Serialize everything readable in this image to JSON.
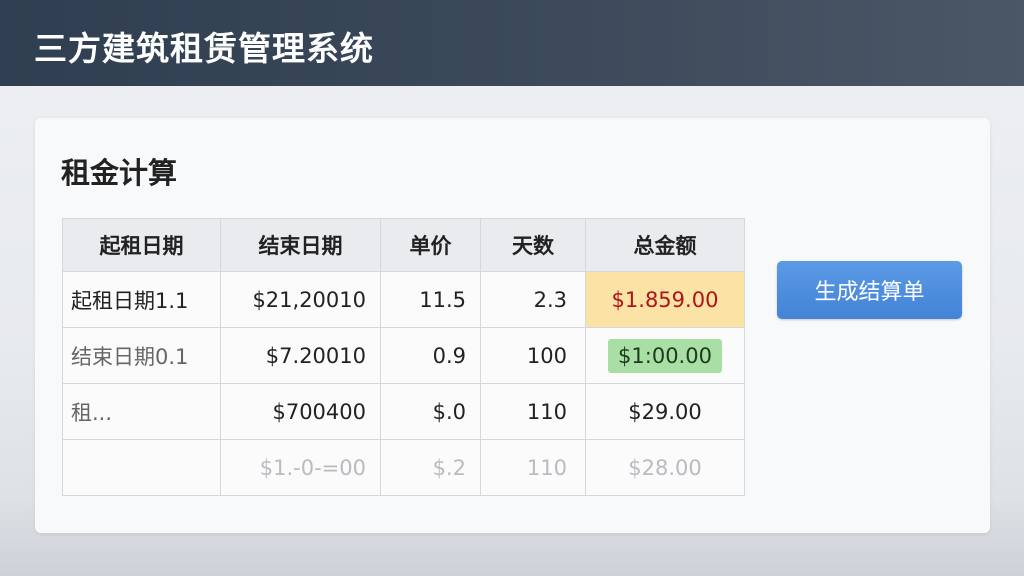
{
  "app": {
    "title": "三方建筑租赁管理系统"
  },
  "panel": {
    "title": "租金计算",
    "generate_button": "生成结算单"
  },
  "table": {
    "headers": [
      "起租日期",
      "结束日期",
      "单价",
      "天数",
      "总金额"
    ],
    "rows": [
      {
        "start": "起租日期1.1",
        "end": "$21,20010",
        "price": "11.5",
        "days": "2.3",
        "total": "$1.859.00"
      },
      {
        "start": "结束日期0.1",
        "end": "$7.20010",
        "price": "0.9",
        "days": "100",
        "total": "$1:00.00"
      },
      {
        "start": "租...",
        "end": "$700400",
        "price": "$.0",
        "days": "110",
        "total": "$29.00"
      },
      {
        "start": "",
        "end": "$1.-0-=00",
        "price": "$.2",
        "days": "110",
        "total": "$28.00"
      }
    ]
  },
  "colors": {
    "header_bar": "#2f3e50",
    "button": "#4a8ddc",
    "highlight_yellow": "#fbe3a6",
    "highlight_green": "#a9dea4",
    "total_red": "#b0131a"
  }
}
